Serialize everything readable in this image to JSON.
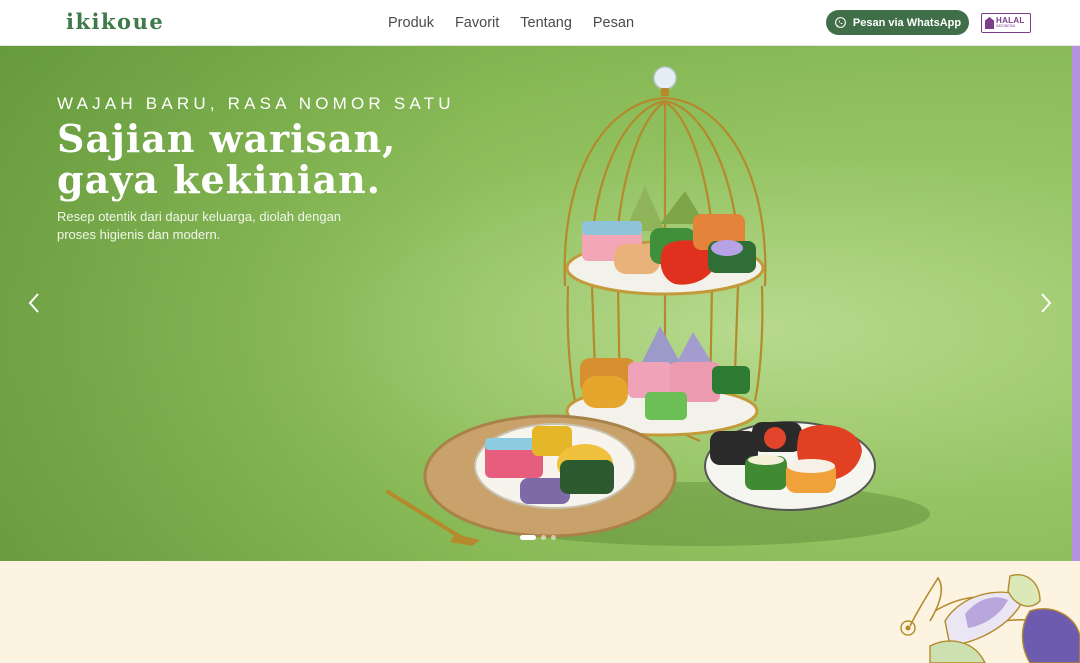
{
  "brand": {
    "logo_text": "ikikoue"
  },
  "nav": {
    "items": [
      "Produk",
      "Favorit",
      "Tentang",
      "Pesan"
    ]
  },
  "header": {
    "whatsapp_label": "Pesan via WhatsApp",
    "halal_text": "HALAL",
    "halal_subtext": "INDONESIA"
  },
  "hero": {
    "eyebrow": "WAJAH BARU, RASA NOMOR SATU",
    "headline_line1": "Sajian warisan,",
    "headline_line2": "gaya kekinian.",
    "subtext": "Resep otentik dari dapur keluarga, diolah dengan proses higienis dan modern.",
    "slide_count": 3,
    "active_slide": 1
  },
  "colors": {
    "brand_green": "#3f6e49",
    "hero_green": "#93c35f",
    "cream": "#fdf3e1",
    "halal_purple": "#7a3e8a",
    "accent_purple": "#b693e0"
  },
  "icons": [
    "whatsapp-icon",
    "chevron-left-icon",
    "chevron-right-icon",
    "halal-logo"
  ]
}
